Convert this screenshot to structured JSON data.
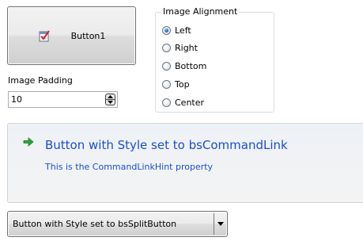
{
  "button1": {
    "label": "Button1",
    "icon": "checklist-icon"
  },
  "image_padding": {
    "label": "Image Padding",
    "value": "10"
  },
  "image_alignment": {
    "title": "Image Alignment",
    "options": [
      {
        "label": "Left",
        "selected": true
      },
      {
        "label": "Right",
        "selected": false
      },
      {
        "label": "Bottom",
        "selected": false
      },
      {
        "label": "Top",
        "selected": false
      },
      {
        "label": "Center",
        "selected": false
      }
    ]
  },
  "command_link": {
    "title": "Button with Style set to bsCommandLink",
    "hint": "This is the CommandLinkHint property",
    "accent_color": "#1a4ed0",
    "arrow_color": "#2aa33a"
  },
  "split_button": {
    "label": "Button with Style set to bsSplitButton"
  }
}
